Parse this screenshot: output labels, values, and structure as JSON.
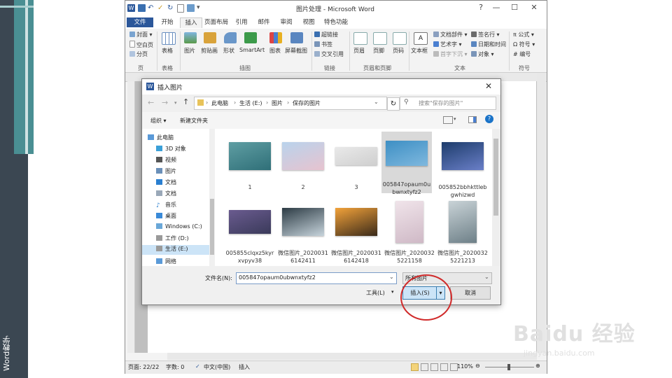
{
  "side": {
    "vertical_label": "Word教学"
  },
  "window": {
    "title": "图片处理 - Microsoft Word",
    "controls": [
      "—",
      "☐",
      "✕"
    ],
    "tabs": [
      "文件",
      "开始",
      "插入",
      "页面布局",
      "引用",
      "邮件",
      "审阅",
      "视图",
      "特色功能"
    ]
  },
  "ribbon": {
    "pages": {
      "cover": "封面 ▾",
      "blank": "空白页",
      "break": "分页",
      "label": "页"
    },
    "table": {
      "btn": "表格",
      "label": "表格"
    },
    "illus": {
      "picture": "图片",
      "clipart": "剪贴画",
      "shapes": "形状",
      "smartart": "SmartArt",
      "chart": "图表",
      "screenshot": "屏幕截图",
      "label": "插图"
    },
    "links": {
      "hyperlink": "超链接",
      "bookmark": "书签",
      "crossref": "交叉引用",
      "label": "链接"
    },
    "hf": {
      "header": "页眉",
      "footer": "页脚",
      "pagenum": "页码",
      "label": "页眉和页脚"
    },
    "text": {
      "textbox": "文本框",
      "parts": "文档部件 ▾",
      "wordart": "艺术字 ▾",
      "dropcap": "首字下沉 ▾",
      "sigline": "签名行 ▾",
      "datetime": "日期和时间",
      "object": "对象 ▾",
      "label": "文本"
    },
    "symbols": {
      "equation": "π 公式 ▾",
      "symbol": "Ω 符号 ▾",
      "number": "# 编号",
      "label": "符号"
    }
  },
  "status": {
    "page": "页面: 22/22",
    "words": "字数: 0",
    "lang": "中文(中国)",
    "mode": "插入",
    "zoom": "110%"
  },
  "dialog": {
    "title": "插入图片",
    "breadcrumb": [
      "此电脑",
      "生活 (E:)",
      "图片",
      "保存的图片"
    ],
    "search_placeholder": "搜索\"保存的图片\"",
    "organize": "组织 ▾",
    "new_folder": "新建文件夹",
    "nav": [
      "此电脑",
      "3D 对象",
      "视频",
      "图片",
      "文档",
      "文档",
      "音乐",
      "桌面",
      "Windows (C:)",
      "工作 (D:)",
      "生活 (E:)",
      "网络"
    ],
    "files": [
      {
        "name": "1",
        "colors": [
          "#5f9ea3",
          "#2f6f78"
        ]
      },
      {
        "name": "2",
        "colors": [
          "#b9d3ec",
          "#e7c3cf"
        ]
      },
      {
        "name": "3",
        "colors": [
          "#e9e9e9",
          "#cfcfcf"
        ]
      },
      {
        "name": "005847opaum0ubwnxtyfz2",
        "colors": [
          "#3d8fc4",
          "#7fb8de"
        ]
      },
      {
        "name": "005852bbhkttlebgwhizwd",
        "colors": [
          "#1d3c6b",
          "#6a7fc8"
        ]
      },
      {
        "name": "005855clqxz5kyrxvpyv38",
        "colors": [
          "#6a5b8f",
          "#3a3a5a"
        ]
      },
      {
        "name": "微信图片_20200316142411",
        "colors": [
          "#2c3b44",
          "#c7d4dc"
        ]
      },
      {
        "name": "微信图片_20200316142418",
        "colors": [
          "#f2a23a",
          "#3a2a1a"
        ]
      },
      {
        "name": "微信图片_20200325221158",
        "colors": [
          "#f0e4ea",
          "#cfb9c6"
        ]
      },
      {
        "name": "微信图片_20200325221213",
        "colors": [
          "#c9d3d7",
          "#6e8088"
        ]
      }
    ],
    "filename_label": "文件名(N):",
    "filename_value": "005847opaum0ubwnxtyfz2",
    "filetype": "所有图片",
    "tools": "工具(L)",
    "insert_btn": "插入(S)",
    "cancel_btn": "取消"
  },
  "watermark": {
    "text": "Baidu 经验",
    "url": "jingyan.baidu.com"
  }
}
